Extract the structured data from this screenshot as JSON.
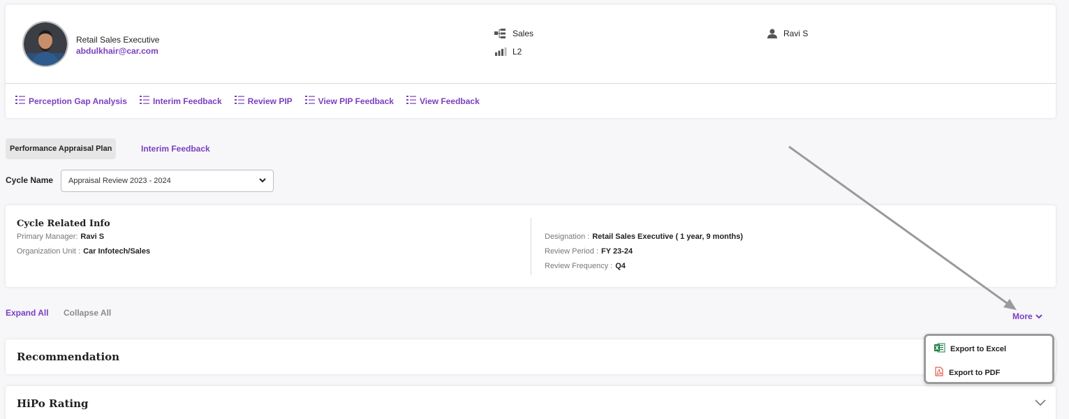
{
  "profile": {
    "role": "Retail Sales Executive",
    "email": "abdulkhair@car.com",
    "department": "Sales",
    "level": "L2",
    "manager": "Ravi S"
  },
  "quicklinks": [
    {
      "label": "Perception Gap Analysis"
    },
    {
      "label": "Interim Feedback"
    },
    {
      "label": "Review PIP"
    },
    {
      "label": "View PIP Feedback"
    },
    {
      "label": "View Feedback"
    }
  ],
  "tabs": {
    "active": "Performance Appraisal Plan",
    "other": "Interim Feedback"
  },
  "cycle": {
    "label": "Cycle Name",
    "selected": "Appraisal Review 2023 - 2024"
  },
  "cycle_info": {
    "title": "Cycle Related Info",
    "primary_manager_label": "Primary Manager:",
    "primary_manager": "Ravi S",
    "org_unit_label": "Organization Unit :",
    "org_unit": "Car Infotech/Sales",
    "designation_label": "Designation :",
    "designation": "Retail Sales Executive ( 1 year, 9 months)",
    "review_period_label": "Review Period :",
    "review_period": "FY 23-24",
    "review_frequency_label": "Review Frequency :",
    "review_frequency": "Q4"
  },
  "controls": {
    "expand_all": "Expand All",
    "collapse_all": "Collapse All",
    "more": "More"
  },
  "sections": [
    {
      "title": "Recommendation"
    },
    {
      "title": "HiPo Rating"
    }
  ],
  "more_menu": [
    {
      "label": "Export to Excel",
      "icon": "excel-icon"
    },
    {
      "label": "Export to PDF",
      "icon": "pdf-icon"
    }
  ],
  "colors": {
    "accent": "#7b3fc0",
    "excel": "#1e7d45",
    "pdf": "#d93a2b"
  }
}
